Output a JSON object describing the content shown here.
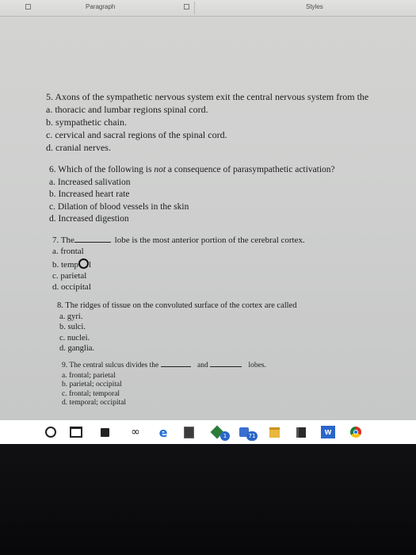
{
  "ribbon": {
    "group_paragraph": "Paragraph",
    "group_styles": "Styles"
  },
  "questions": [
    {
      "stem": "5. Axons of the sympathetic nervous system exit the central nervous system from the",
      "options": [
        "a. thoracic and lumbar regions spinal cord.",
        "b. sympathetic chain.",
        "c. cervical and sacral regions of the spinal cord.",
        "d. cranial nerves."
      ]
    },
    {
      "stem_before": "6. Which of the following is ",
      "stem_emphasis": "not",
      "stem_after": " a consequence of parasympathetic activation?",
      "options": [
        "a. Increased salivation",
        "b. Increased heart rate",
        "c. Dilation of blood vessels in the skin",
        "d. Increased digestion"
      ]
    },
    {
      "stem_before": "7. The",
      "stem_after": "lobe is the most anterior portion of the cerebral cortex.",
      "options": [
        "a. frontal",
        "b. temp",
        "c. parietal",
        "d. occipital"
      ],
      "option_b_tail": "l"
    },
    {
      "stem": "8. The ridges of tissue on the convoluted surface of the cortex are called",
      "options": [
        "a. gyri.",
        "b. sulci.",
        "c. nuclei.",
        "d. ganglia."
      ]
    },
    {
      "stem_before": "9. The central sulcus divides the",
      "stem_mid": "and",
      "stem_after": "lobes.",
      "options": [
        "a. frontal; parietal",
        "b. parietal; occipital",
        "c. frontal; temporal",
        "d. temporal; occipital"
      ]
    }
  ],
  "taskbar": {
    "icons": [
      "cortana-circle-icon",
      "task-view-icon",
      "store-icon",
      "infinity-app-icon",
      "edge-icon",
      "calculator-icon",
      "app-badge-icon",
      "app-badge-icon",
      "file-explorer-icon",
      "book-icon",
      "word-icon",
      "chrome-icon"
    ],
    "badge_1": "1",
    "badge_2": "71",
    "word_letter": "W",
    "accent": "#2a66c8"
  }
}
